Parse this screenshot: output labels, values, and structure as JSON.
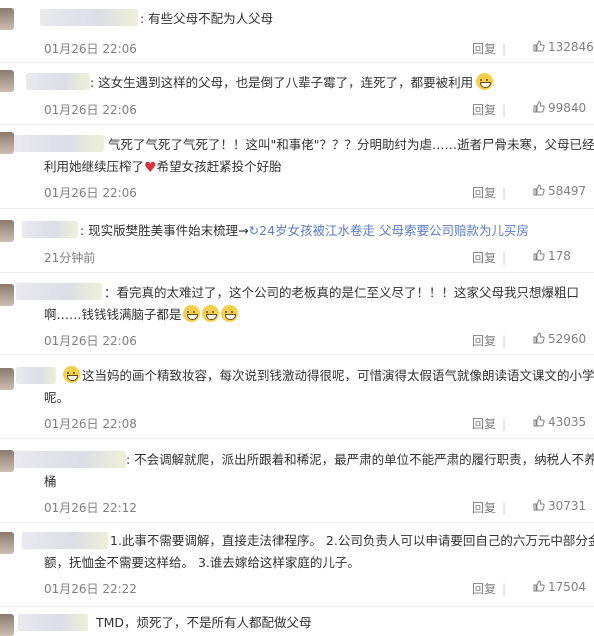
{
  "comments": [
    {
      "lines": [
        ": 有些父母不配为人父母"
      ],
      "time": "01月26日 22:06",
      "reply": "回复",
      "likes": "132846"
    },
    {
      "lines": [
        ": 这女生遇到这样的父母，也是倒了八辈子霉了，连死了，都要被利用"
      ],
      "time": "01月26日 22:06",
      "reply": "回复",
      "likes": "99840"
    },
    {
      "lines": [
        "气死了气死了气死了！！这叫\"和事佬\"？？？分明助纣为虐……逝者尸骨未寒，父母已经在",
        "利用她继续压榨了",
        "希望女孩赶紧投个好胎"
      ],
      "time": "01月26日 22:06",
      "reply": "回复",
      "likes": "58497"
    },
    {
      "lines": [
        ": 现实版樊胜美事件始末梳理→",
        "24岁女孩被江水卷走 父母索要公司赔款为儿买房"
      ],
      "time": "21分钟前",
      "reply": "回复",
      "likes": "178"
    },
    {
      "lines": [
        "：看完真的太难过了，这个公司的老板真的是仁至义尽了！！！这家父母我只想爆粗口",
        "啊……钱钱钱满脑子都是"
      ],
      "time": "01月26日 22:06",
      "reply": "回复",
      "likes": "52960"
    },
    {
      "lines": [
        "这当妈的画个精致妆容，每次说到钱激动得很呢，可惜演得太假语气就像朗读语文课文的小学生",
        "呢。"
      ],
      "time": "01月26日 22:08",
      "reply": "回复",
      "likes": "43035"
    },
    {
      "lines": [
        ": 不会调解就爬，派出所跟着和稀泥，最严肃的单位不能严肃的履行职责，纳税人不养饭",
        "桶"
      ],
      "time": "01月26日 22:12",
      "reply": "回复",
      "likes": "30731"
    },
    {
      "lines": [
        "1.此事不需要调解，直接走法律程序。 2.公司负责人可以申请要回自己的六万元中部分金",
        "额，抚恤金不需要这样给。 3.谁去嫁给这样家庭的儿子。"
      ],
      "time": "01月26日 22:22",
      "reply": "回复",
      "likes": "17504"
    },
    {
      "lines": [
        "TMD，烦死了，不是所有人都配做父母"
      ]
    }
  ],
  "icons": {
    "thumb": "thumbs-up-icon",
    "emoji": "grin-emoji-icon",
    "heart": "broken-heart-icon"
  },
  "colors": {
    "link": "#5b7ec4",
    "meta": "#808080"
  }
}
